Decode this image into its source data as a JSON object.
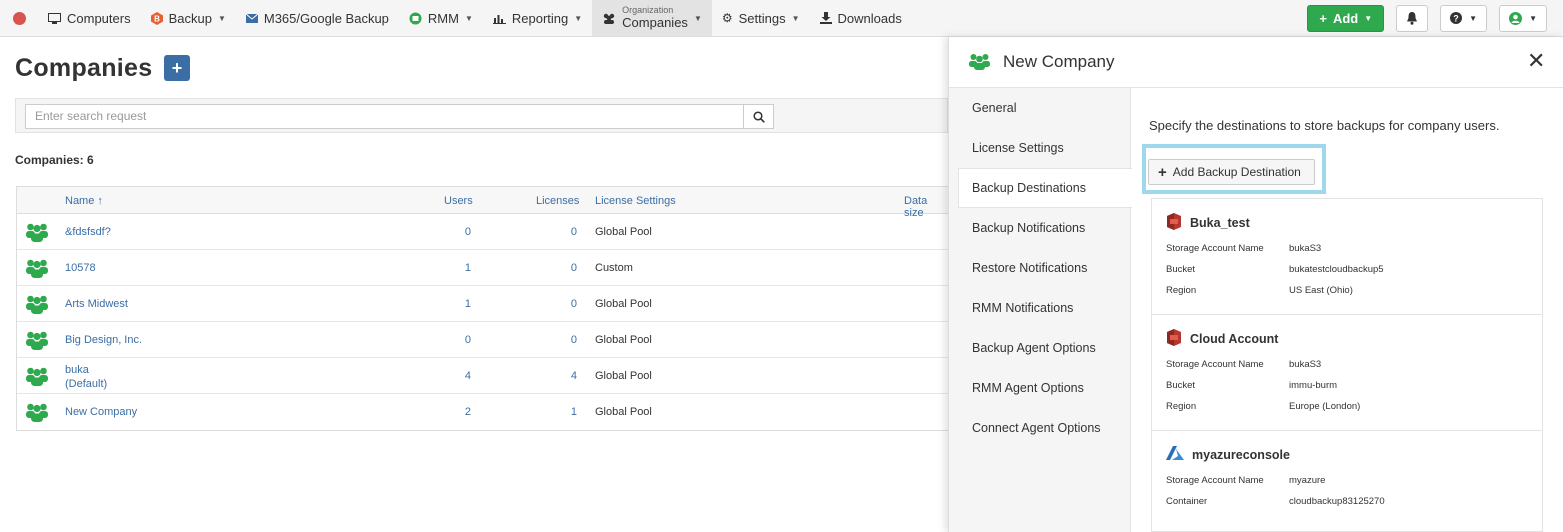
{
  "nav": {
    "items": [
      {
        "label": "Computers",
        "icon": "monitor-icon",
        "caret": false
      },
      {
        "label": "Backup",
        "icon": "backup-icon",
        "caret": true
      },
      {
        "label": "M365/Google Backup",
        "icon": "envelope-icon",
        "caret": false
      },
      {
        "label": "RMM",
        "icon": "rmm-icon",
        "caret": true
      },
      {
        "label": "Reporting",
        "icon": "bar-chart-icon",
        "caret": true
      }
    ],
    "org_small": "Organization",
    "org_big": "Companies",
    "settings": "Settings",
    "downloads": "Downloads",
    "add_label": "Add"
  },
  "page": {
    "title": "Companies",
    "add_symbol": "+",
    "search_placeholder": "Enter search request",
    "count_label": "Companies: 6"
  },
  "table": {
    "headers": {
      "name": "Name ↑",
      "users": "Users",
      "licenses": "Licenses",
      "license_settings": "License Settings",
      "data_size": "Data size"
    },
    "rows": [
      {
        "name": "&fdsfsdf?",
        "sub": "",
        "users": "0",
        "licenses": "0",
        "license_settings": "Global Pool"
      },
      {
        "name": "10578",
        "sub": "",
        "users": "1",
        "licenses": "0",
        "license_settings": "Custom"
      },
      {
        "name": "Arts Midwest",
        "sub": "",
        "users": "1",
        "licenses": "0",
        "license_settings": "Global Pool"
      },
      {
        "name": "Big Design, Inc.",
        "sub": "",
        "users": "0",
        "licenses": "0",
        "license_settings": "Global Pool"
      },
      {
        "name": "buka",
        "sub": "(Default)",
        "users": "4",
        "licenses": "4",
        "license_settings": "Global Pool"
      },
      {
        "name": "New Company",
        "sub": "",
        "users": "2",
        "licenses": "1",
        "license_settings": "Global Pool"
      }
    ]
  },
  "panel": {
    "title": "New Company",
    "close": "✕",
    "tabs": [
      "General",
      "License Settings",
      "Backup Destinations",
      "Backup Notifications",
      "Restore Notifications",
      "RMM Notifications",
      "Backup Agent Options",
      "RMM Agent Options",
      "Connect Agent Options"
    ],
    "active_tab": "Backup Destinations",
    "description": "Specify the destinations to store backups for company users.",
    "add_destination": "Add Backup Destination",
    "destinations": [
      {
        "name": "Buka_test",
        "icon": "aws-s3-icon",
        "fields": [
          [
            "Storage Account Name",
            "bukaS3"
          ],
          [
            "Bucket",
            "bukatestcloudbackup5"
          ],
          [
            "Region",
            "US East (Ohio)"
          ]
        ]
      },
      {
        "name": "Cloud Account",
        "icon": "aws-s3-icon",
        "fields": [
          [
            "Storage Account Name",
            "bukaS3"
          ],
          [
            "Bucket",
            "immu-burm"
          ],
          [
            "Region",
            "Europe (London)"
          ]
        ]
      },
      {
        "name": "myazureconsole",
        "icon": "azure-icon",
        "fields": [
          [
            "Storage Account Name",
            "myazure"
          ],
          [
            "Container",
            "cloudbackup83125270"
          ]
        ]
      }
    ]
  },
  "colors": {
    "accent": "#3a6ea5",
    "green": "#2fa94e",
    "highlight": "#9fd8ec"
  }
}
